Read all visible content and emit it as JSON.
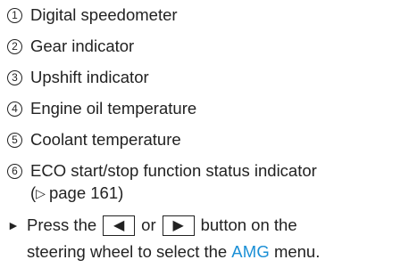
{
  "legend": [
    {
      "num": "1",
      "text": "Digital speedometer"
    },
    {
      "num": "2",
      "text": "Gear indicator"
    },
    {
      "num": "3",
      "text": "Upshift indicator"
    },
    {
      "num": "4",
      "text": "Engine oil temperature"
    },
    {
      "num": "5",
      "text": "Coolant temperature"
    },
    {
      "num": "6",
      "text": "ECO start/stop function status indicator"
    }
  ],
  "reference": {
    "open": "(",
    "arrow": "▷",
    "text": "page 161)"
  },
  "instruction": {
    "bullet": "►",
    "part1": "Press the",
    "left_key": "◀",
    "or": "or",
    "right_key": "▶",
    "part2": "button on the",
    "line2_start": "steering wheel to select the",
    "menu_name": "AMG",
    "line2_end": "menu.",
    "accent_color": "#1a8fd6"
  }
}
